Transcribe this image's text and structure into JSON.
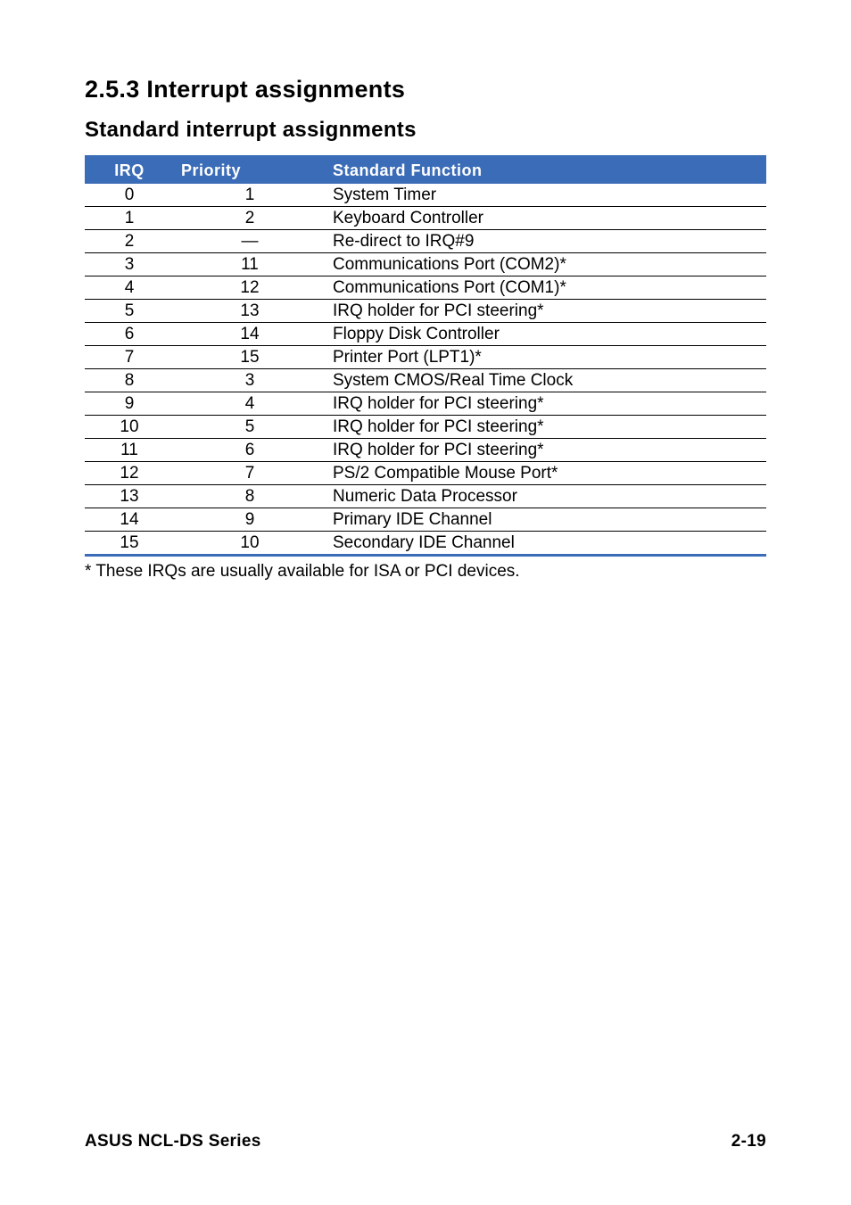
{
  "headings": {
    "section": "2.5.3   Interrupt assignments",
    "subsection": "Standard interrupt assignments"
  },
  "table": {
    "header": {
      "irq": "IRQ",
      "priority": "Priority",
      "func": "Standard Function"
    },
    "rows": [
      {
        "irq": "0",
        "priority": "1",
        "func": "System Timer"
      },
      {
        "irq": "1",
        "priority": "2",
        "func": "Keyboard Controller"
      },
      {
        "irq": "2",
        "priority": "—",
        "func": "Re-direct to IRQ#9"
      },
      {
        "irq": "3",
        "priority": "11",
        "func": "Communications Port (COM2)*"
      },
      {
        "irq": "4",
        "priority": "12",
        "func": "Communications Port (COM1)*"
      },
      {
        "irq": "5",
        "priority": "13",
        "func": "IRQ holder for PCI steering*"
      },
      {
        "irq": "6",
        "priority": "14",
        "func": "Floppy Disk Controller"
      },
      {
        "irq": "7",
        "priority": "15",
        "func": "Printer Port (LPT1)*"
      },
      {
        "irq": "8",
        "priority": "3",
        "func": "System CMOS/Real Time Clock"
      },
      {
        "irq": "9",
        "priority": "4",
        "func": "IRQ holder for PCI steering*"
      },
      {
        "irq": "10",
        "priority": "5",
        "func": "IRQ holder for PCI steering*"
      },
      {
        "irq": "11",
        "priority": "6",
        "func": "IRQ holder for PCI steering*"
      },
      {
        "irq": "12",
        "priority": "7",
        "func": "PS/2 Compatible Mouse Port*"
      },
      {
        "irq": "13",
        "priority": "8",
        "func": "Numeric Data Processor"
      },
      {
        "irq": "14",
        "priority": "9",
        "func": "Primary IDE Channel"
      },
      {
        "irq": "15",
        "priority": "10",
        "func": "Secondary IDE Channel"
      }
    ]
  },
  "footnote": "* These IRQs are usually available for ISA or PCI devices.",
  "footer": {
    "left": "ASUS NCL-DS Series",
    "right": "2-19"
  }
}
